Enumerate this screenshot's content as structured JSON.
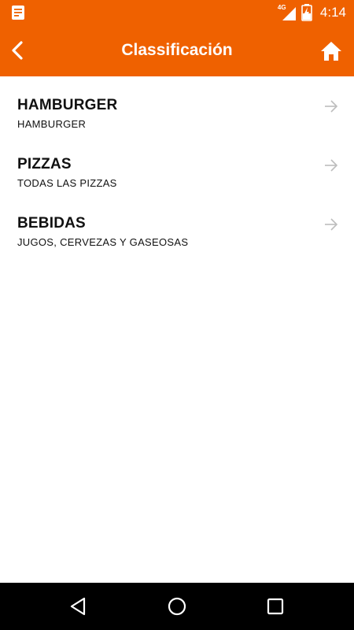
{
  "status_bar": {
    "network_label": "4G",
    "time": "4:14",
    "icons": [
      "notification-doc-icon",
      "signal-icon",
      "battery-charging-icon"
    ]
  },
  "app_bar": {
    "title": "Classificación",
    "back_icon": "chevron-left-icon",
    "home_icon": "home-icon"
  },
  "categories": [
    {
      "title": "HAMBURGER",
      "subtitle": "HAMBURGER"
    },
    {
      "title": "PIZZAS",
      "subtitle": "TODAS LAS PIZZAS"
    },
    {
      "title": "BEBIDAS",
      "subtitle": "JUGOS, CERVEZAS Y GASEOSAS"
    }
  ],
  "nav_bar": {
    "icons": [
      "nav-back-icon",
      "nav-home-icon",
      "nav-recents-icon"
    ]
  },
  "colors": {
    "primary": "#ef6100",
    "background": "#ffffff",
    "text": "#111111",
    "arrow": "#bdbdbd",
    "nav_bar": "#000000"
  }
}
